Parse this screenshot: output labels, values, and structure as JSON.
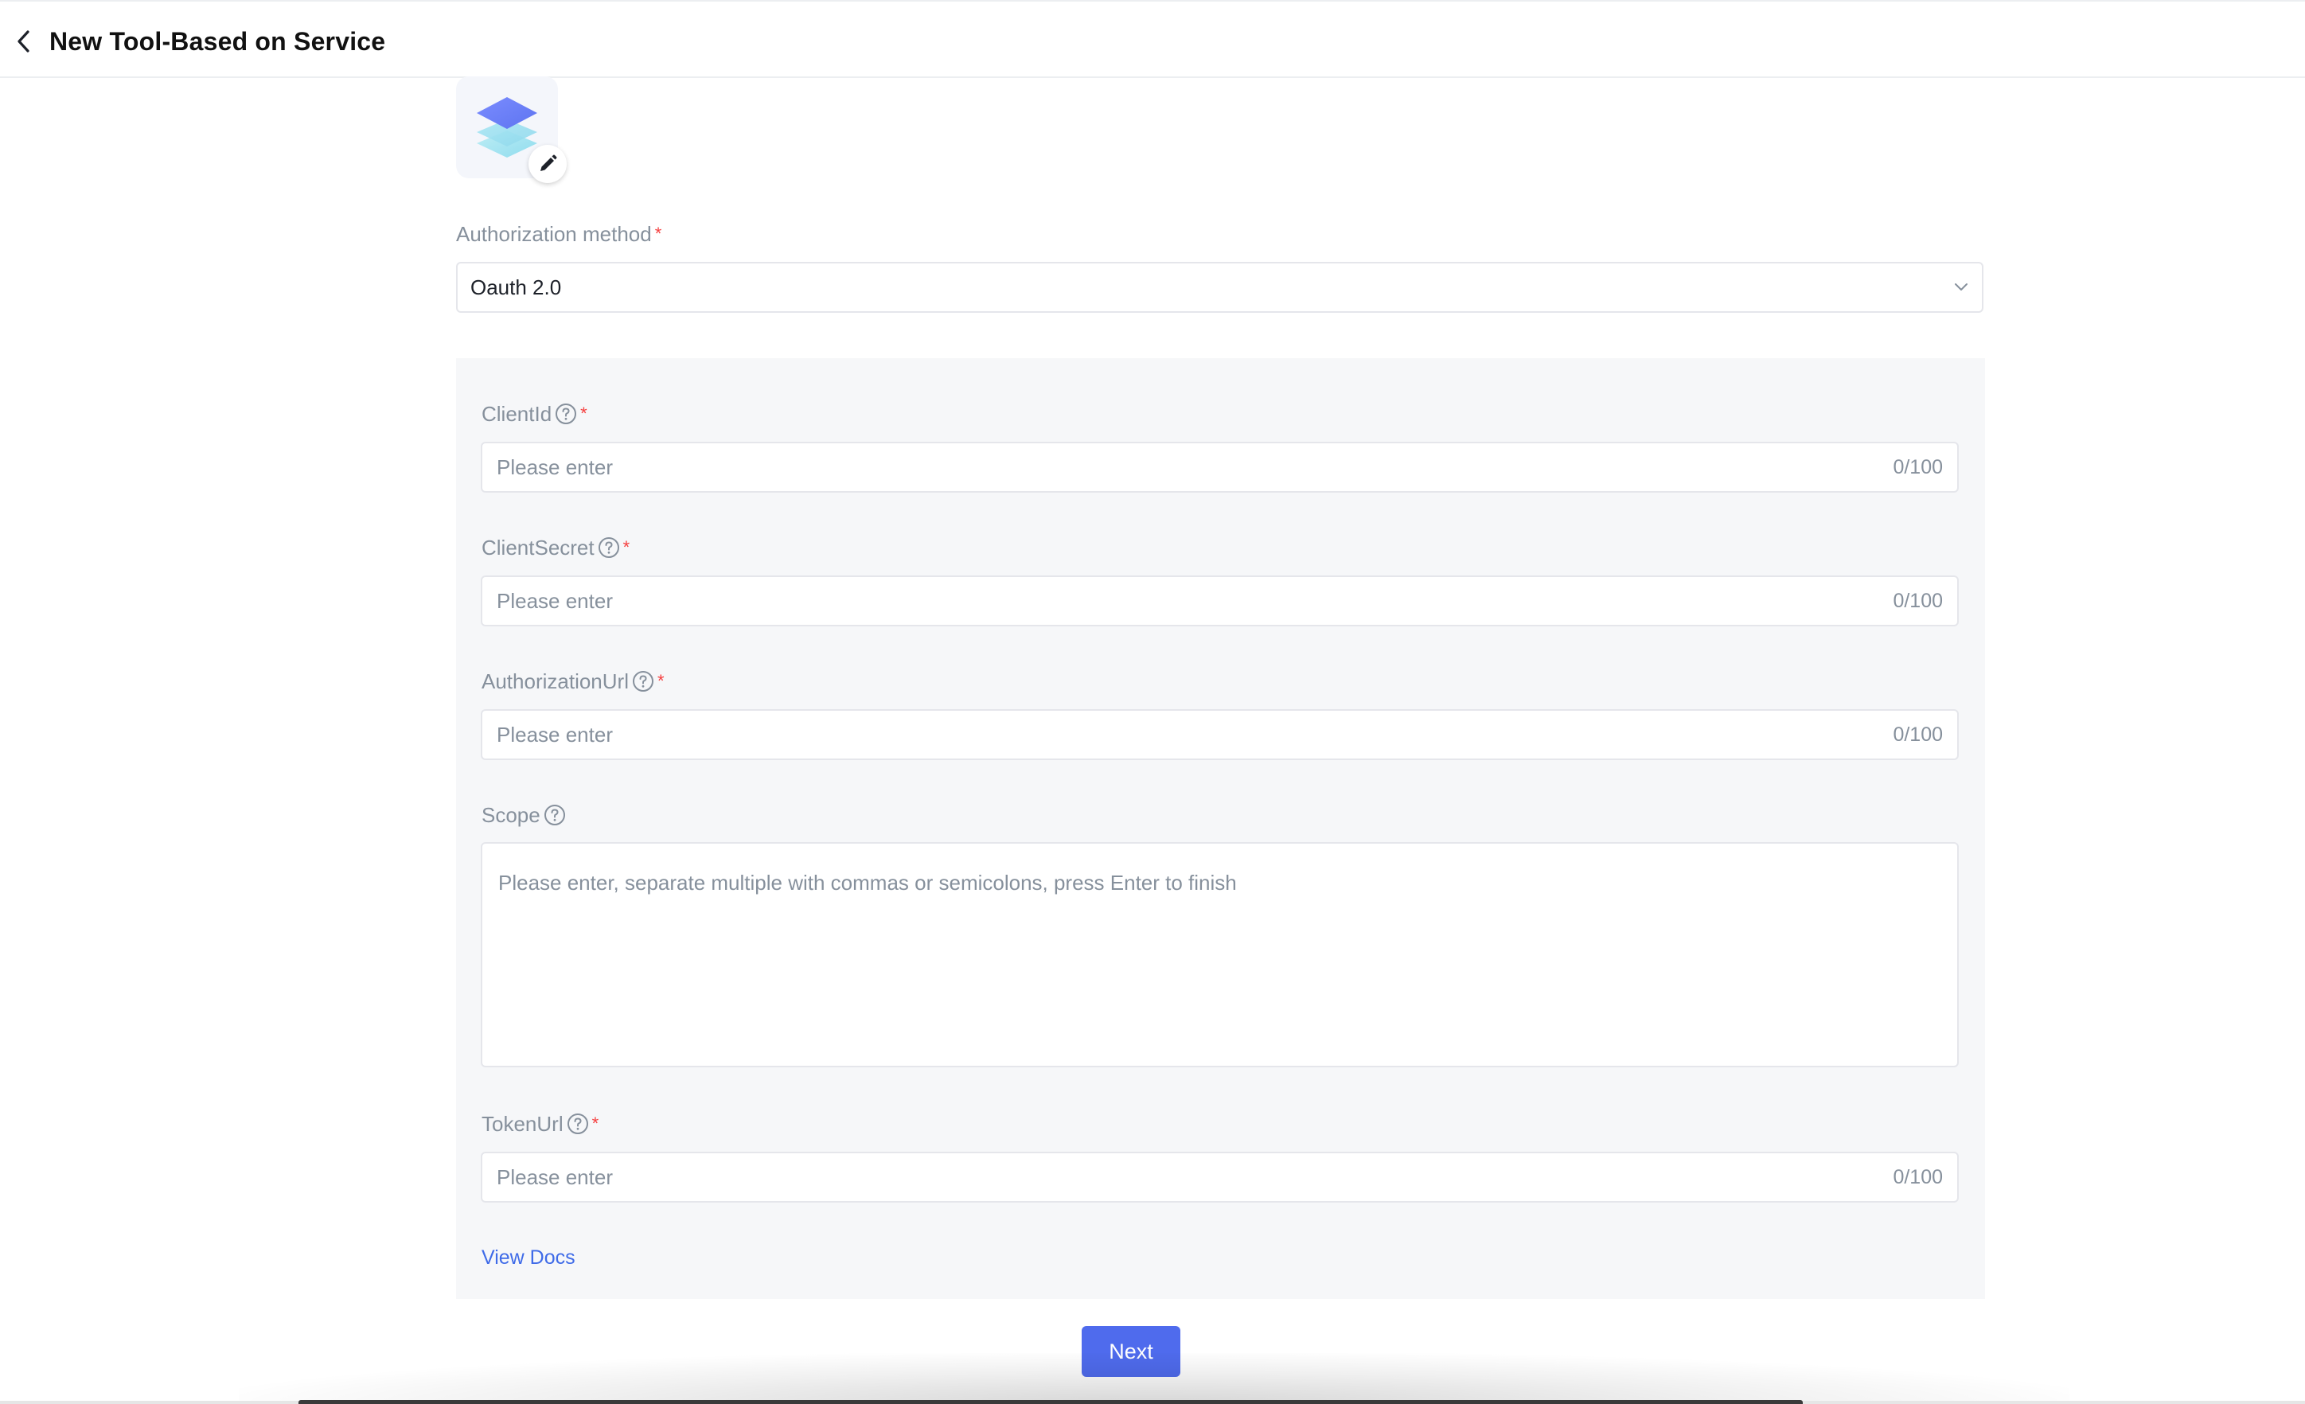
{
  "header": {
    "title": "New Tool-Based on Service"
  },
  "form": {
    "auth_method": {
      "label": "Authorization method",
      "value": "Oauth 2.0"
    },
    "client_id": {
      "label": "ClientId",
      "placeholder": "Please enter",
      "counter": "0/100"
    },
    "client_secret": {
      "label": "ClientSecret",
      "placeholder": "Please enter",
      "counter": "0/100"
    },
    "authorization_url": {
      "label": "AuthorizationUrl",
      "placeholder": "Please enter",
      "counter": "0/100"
    },
    "scope": {
      "label": "Scope",
      "placeholder": "Please enter, separate multiple with commas or semicolons, press Enter to finish"
    },
    "token_url": {
      "label": "TokenUrl",
      "placeholder": "Please enter",
      "counter": "0/100"
    },
    "required_mark": "*",
    "view_docs": "View Docs",
    "next": "Next"
  },
  "icons": {
    "back": "chevron-left-icon",
    "edit": "pencil-icon",
    "help": "question-circle-icon",
    "dropdown": "chevron-down-icon",
    "avatar": "layers-icon"
  },
  "colors": {
    "primary": "#4f6bed",
    "link": "#3f6be8",
    "required": "#f53f3f",
    "panel_bg": "#f6f7f9"
  }
}
